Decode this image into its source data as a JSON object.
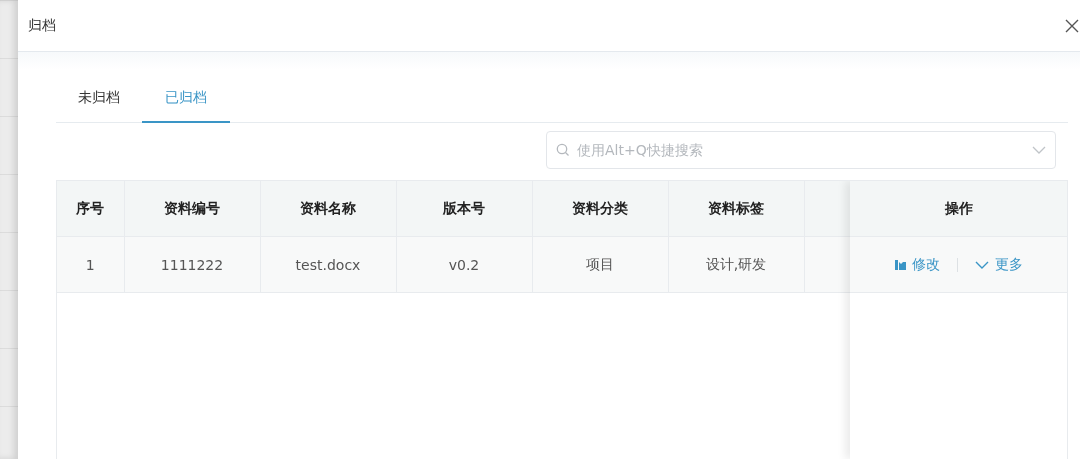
{
  "window": {
    "title": "归档"
  },
  "tabs": [
    {
      "label": "未归档",
      "selected": false
    },
    {
      "label": "已归档",
      "selected": true
    }
  ],
  "search": {
    "placeholder": "使用Alt+Q快捷搜索"
  },
  "table": {
    "columns": [
      "序号",
      "资料编号",
      "资料名称",
      "版本号",
      "资料分类",
      "资料标签"
    ],
    "fixed_column": "操作",
    "rows": [
      {
        "cells": [
          "1",
          "1111222",
          "test.docx",
          "v0.2",
          "项目",
          "设计,研发"
        ],
        "actions": [
          "修改",
          "更多"
        ]
      }
    ]
  }
}
